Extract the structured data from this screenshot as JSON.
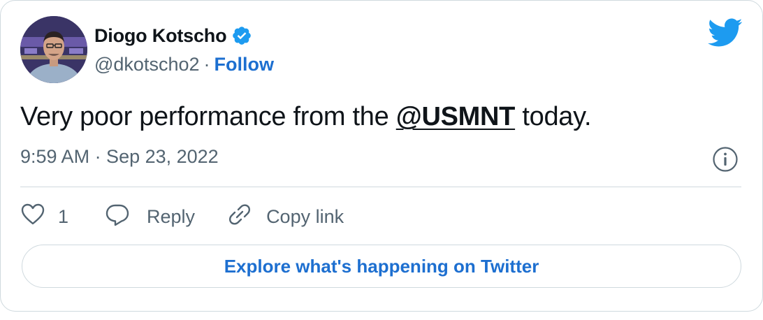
{
  "author": {
    "display_name": "Diogo Kotscho",
    "handle": "@dkotscho2",
    "separator": "·",
    "follow_label": "Follow",
    "verified": true,
    "avatar": "profile-photo"
  },
  "tweet": {
    "text_before": "Very poor performance from the ",
    "mention": "@USMNT",
    "text_after": " today.",
    "timestamp": "9:59 AM · Sep 23, 2022"
  },
  "actions": {
    "like_icon": "heart-icon",
    "like_count": "1",
    "reply_icon": "speech-bubble-icon",
    "reply_label": "Reply",
    "copy_icon": "link-icon",
    "copy_label": "Copy link"
  },
  "footer": {
    "explore_label": "Explore what's happening on Twitter"
  },
  "colors": {
    "brand": "#1d9bf0",
    "link": "#1d6fd0",
    "secondary_text": "#536471",
    "border": "#cfd9de"
  }
}
